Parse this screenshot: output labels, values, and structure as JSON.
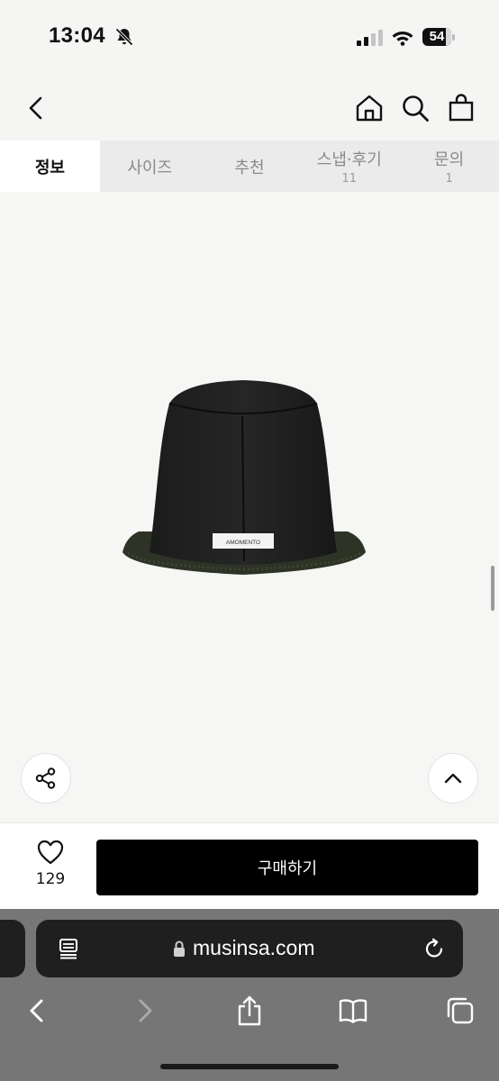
{
  "status_bar": {
    "time": "13:04",
    "battery_level": "54"
  },
  "header": {
    "icons": [
      "back-icon",
      "home-icon",
      "search-icon",
      "bag-icon"
    ]
  },
  "tabs": [
    {
      "label": "정보",
      "count": "",
      "active": true
    },
    {
      "label": "사이즈",
      "count": "",
      "active": false
    },
    {
      "label": "추천",
      "count": "",
      "active": false
    },
    {
      "label": "스냅·후기",
      "count": "11",
      "active": false
    },
    {
      "label": "문의",
      "count": "1",
      "active": false
    }
  ],
  "product": {
    "image_label": "AMOMENTO"
  },
  "buy_bar": {
    "like_count": "129",
    "buy_label": "구매하기"
  },
  "browser": {
    "url": "musinsa.com"
  },
  "colors": {
    "buy_button": "#000000",
    "page_background": "#f5f5f4",
    "browser_chrome": "#767676"
  }
}
